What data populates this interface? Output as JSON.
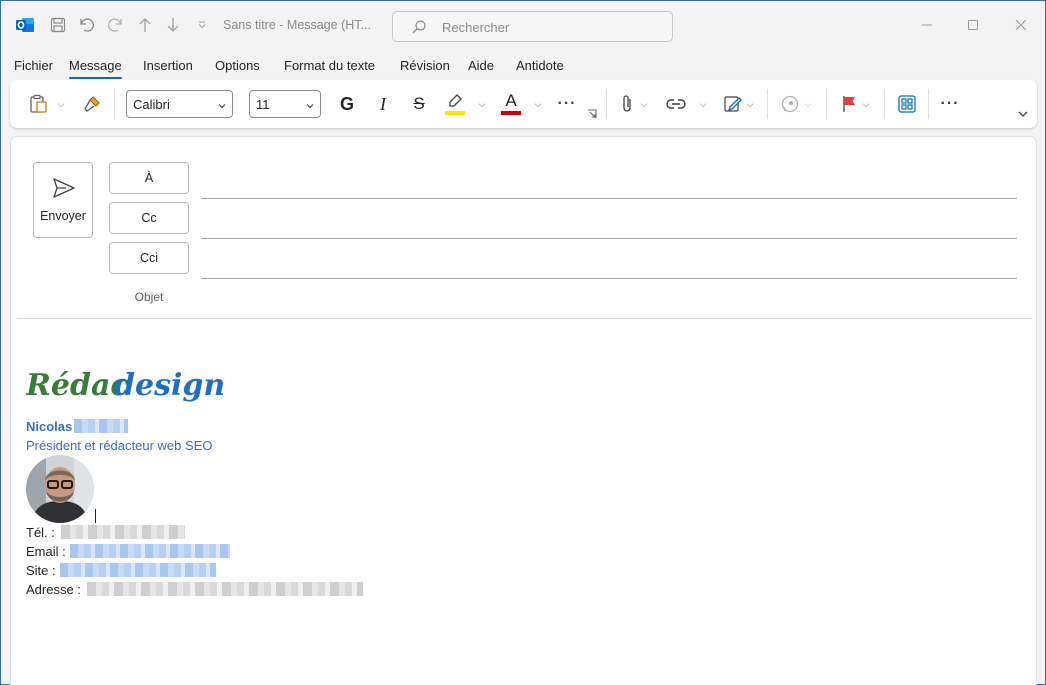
{
  "window": {
    "title": "Sans titre  -  Message (HT...",
    "search_placeholder": "Rechercher"
  },
  "menu_tabs": [
    "Fichier",
    "Message",
    "Insertion",
    "Options",
    "Format du texte",
    "Révision",
    "Aide",
    "Antidote"
  ],
  "active_tab": "Message",
  "ribbon": {
    "font_name": "Calibri",
    "font_size": "11",
    "bold_label": "G",
    "italic_label": "I",
    "strike_label": "S",
    "font_color_label": "A",
    "more_label": "···",
    "highlight_color": "#f5e50a",
    "font_color": "#d00000"
  },
  "compose": {
    "send_label": "Envoyer",
    "to_label": "À",
    "cc_label": "Cc",
    "bcc_label": "Cci",
    "subject_label": "Objet"
  },
  "signature": {
    "logo_text_a": "Rédac",
    "logo_text_b": "design",
    "name": "Nicolas",
    "role": "Président et rédacteur web SEO",
    "tel_label": "Tél. :",
    "email_label": "Email :",
    "site_label": "Site :",
    "address_label": "Adresse :"
  },
  "colors": {
    "accent": "#0f6cbd",
    "signature_blue": "#3a6fc4",
    "logo_green": "#3a7d3a",
    "logo_blue": "#1f6fc0"
  }
}
